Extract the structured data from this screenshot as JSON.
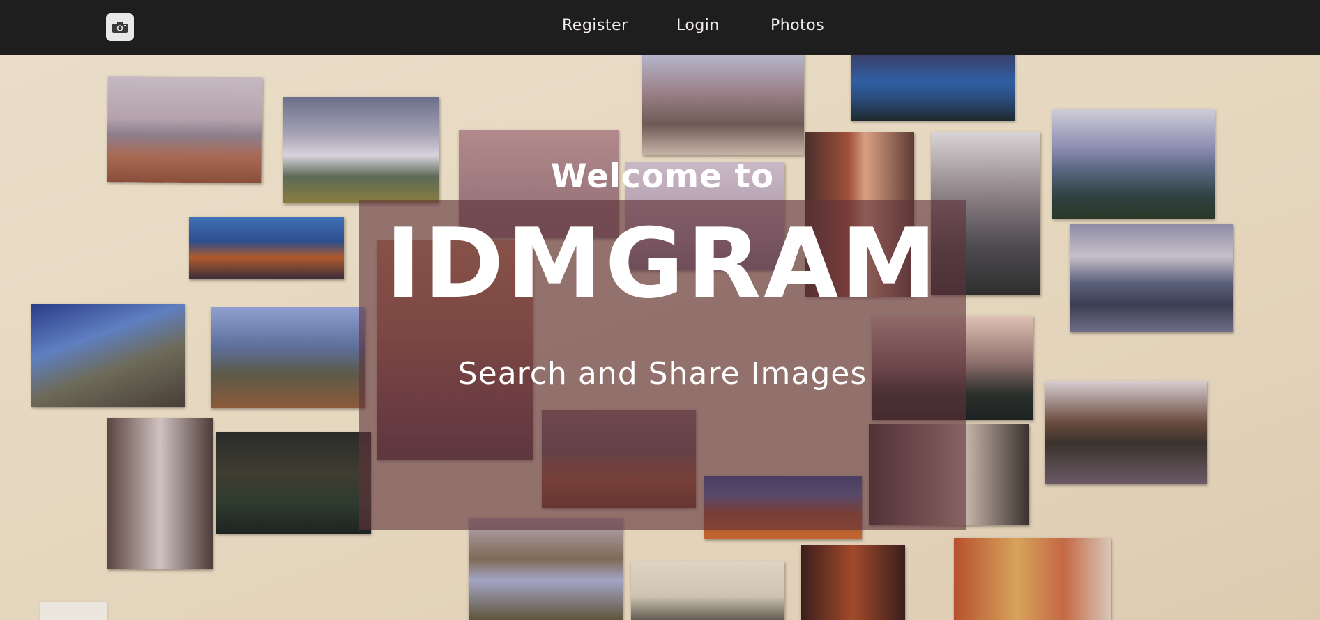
{
  "logo": {
    "icon": "camera-icon"
  },
  "nav": {
    "register": "Register",
    "login": "Login",
    "photos": "Photos"
  },
  "hero": {
    "welcome": "Welcome to",
    "brand": "IDMGRAM",
    "tagline": "Search and Share Images"
  },
  "colors": {
    "navbar_bg": "#1f1e1f",
    "nav_text": "#f2ecea",
    "overlay": "rgba(95, 50, 58, 0.62)",
    "wall": "#e7d9c1"
  }
}
